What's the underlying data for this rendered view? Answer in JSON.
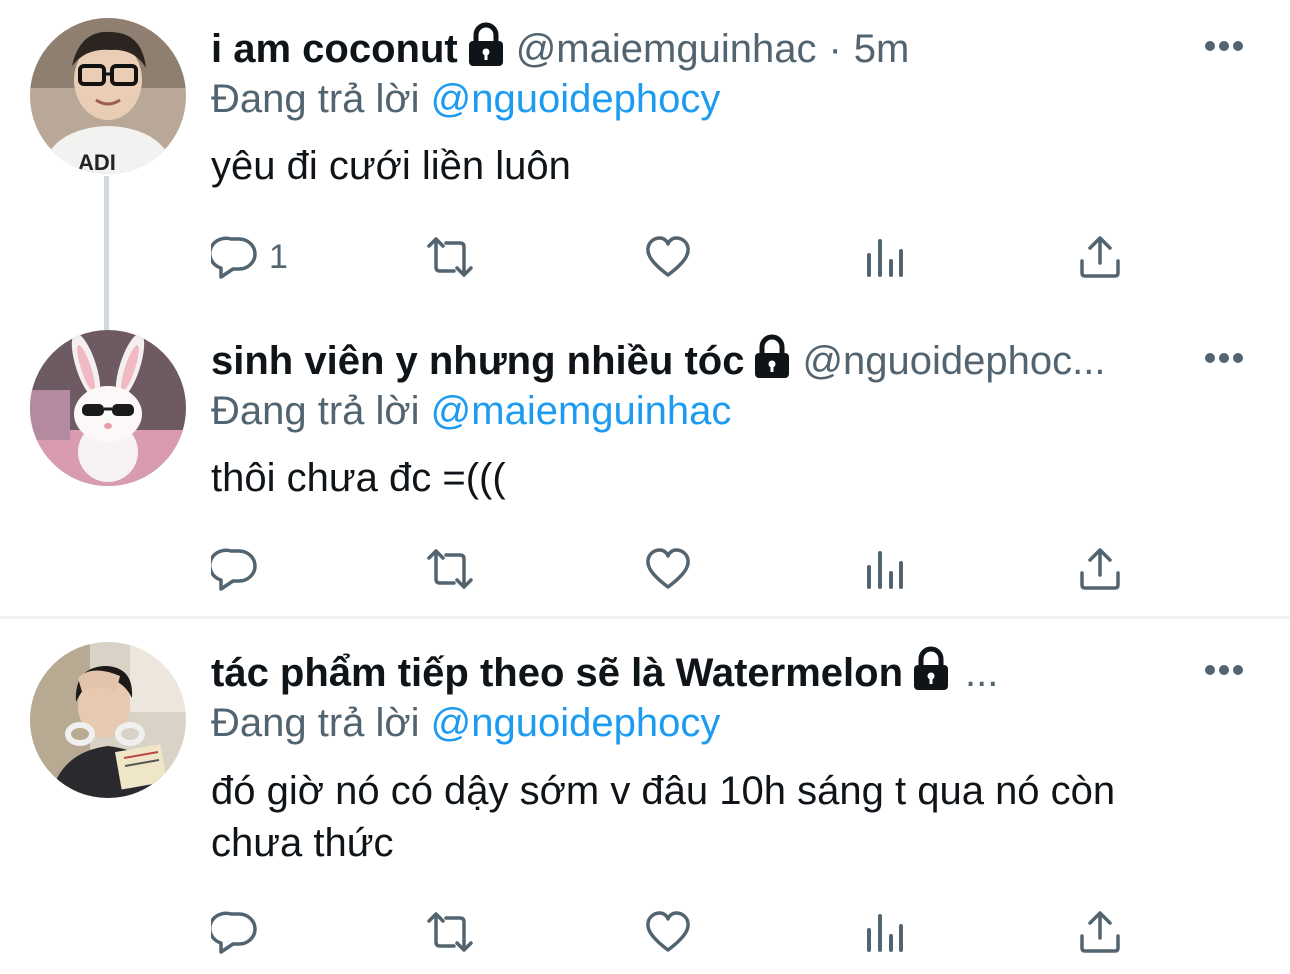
{
  "tweets": [
    {
      "display_name": "i am coconut",
      "handle": "@maiemguinhac",
      "separator": "·",
      "time": "5m",
      "reply_prefix": "Đang trả lời ",
      "reply_mention": "@nguoidephocy",
      "text": "yêu đi cưới liền luôn",
      "reply_count": "1",
      "avatar_icon": "profile-photo-boy-glasses",
      "locked": true
    },
    {
      "display_name": "sinh viên y nhưng nhiều tóc",
      "handle": "@nguoidephoc...",
      "reply_prefix": "Đang trả lời ",
      "reply_mention": "@maiemguinhac",
      "text": "thôi chưa đc =(((",
      "reply_count": "",
      "avatar_icon": "profile-photo-bunny-sunglasses",
      "locked": true
    },
    {
      "display_name": "tác phẩm tiếp theo sẽ là Watermelon",
      "handle": "...",
      "reply_prefix": "Đang trả lời ",
      "reply_mention": "@nguoidephocy",
      "text": "đó giờ nó có dậy sớm v đâu 10h sáng t qua nó còn chưa thức",
      "reply_count": "",
      "avatar_icon": "profile-photo-person-headphones",
      "locked": true
    }
  ],
  "icons": {
    "reply": "speech-bubble-icon",
    "retweet": "retweet-arrows-icon",
    "like": "heart-icon",
    "analytics": "bar-chart-icon",
    "share": "share-upload-icon",
    "more": "ellipsis-icon",
    "lock": "lock-icon"
  },
  "colors": {
    "text": "#0f1419",
    "secondary": "#536471",
    "link": "#1d9bf0",
    "divider": "#eff3f4",
    "thread_line": "#cfd9de"
  }
}
